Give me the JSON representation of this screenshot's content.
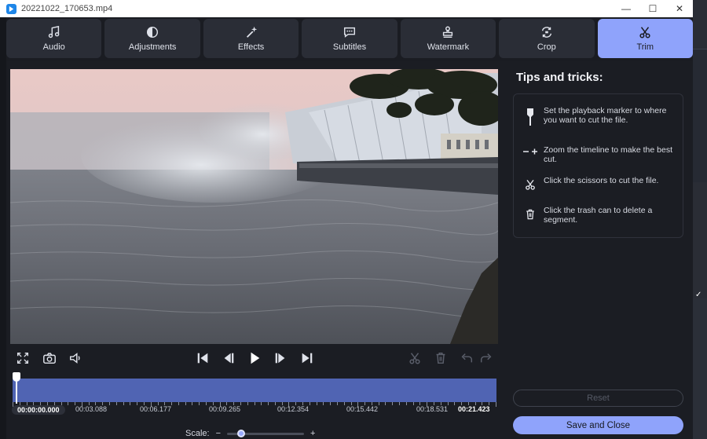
{
  "window": {
    "title": "20221022_170653.mp4",
    "controls": {
      "minimize": "—",
      "maximize": "☐",
      "close": "✕"
    }
  },
  "tabs": [
    {
      "label": "Audio",
      "icon": "music-note-icon",
      "active": false
    },
    {
      "label": "Adjustments",
      "icon": "contrast-icon",
      "active": false
    },
    {
      "label": "Effects",
      "icon": "magic-wand-icon",
      "active": false
    },
    {
      "label": "Subtitles",
      "icon": "speech-bubble-icon",
      "active": false
    },
    {
      "label": "Watermark",
      "icon": "stamp-icon",
      "active": false
    },
    {
      "label": "Crop",
      "icon": "crop-rotate-icon",
      "active": false
    },
    {
      "label": "Trim",
      "icon": "scissors-icon",
      "active": true
    }
  ],
  "player": {
    "left_icons": [
      "fullscreen-icon",
      "camera-icon",
      "speaker-icon"
    ],
    "center_icons": [
      "skip-start-icon",
      "prev-frame-icon",
      "play-icon",
      "next-frame-icon",
      "skip-end-icon"
    ],
    "right_icons": [
      "scissors-icon",
      "trash-icon",
      "undo-icon",
      "redo-icon"
    ]
  },
  "timeline": {
    "current_time": "00:00:00.000",
    "labels": [
      "00:03.088",
      "00:06.177",
      "00:09.265",
      "00:12.354",
      "00:15.442",
      "00:18.531"
    ],
    "end_time": "00:21.423",
    "playhead_fraction": 0.0
  },
  "scale": {
    "label": "Scale:",
    "minus": "−",
    "plus": "+",
    "value_fraction": 0.15
  },
  "tips": {
    "title": "Tips and tricks:",
    "items": [
      {
        "icon": "playback-marker-icon",
        "text": "Set the playback marker to where you want to cut the file."
      },
      {
        "icon": "zoom-timeline-icon",
        "text": "Zoom the timeline to make the best cut."
      },
      {
        "icon": "scissors-icon",
        "text": "Click the scissors to cut the file."
      },
      {
        "icon": "trash-icon",
        "text": "Click the trash can to delete a segment."
      }
    ]
  },
  "buttons": {
    "reset": "Reset",
    "save_close": "Save and Close"
  },
  "colors": {
    "accent": "#8fa3fb",
    "timeline": "#5064b3",
    "panel": "#1b1d23"
  }
}
